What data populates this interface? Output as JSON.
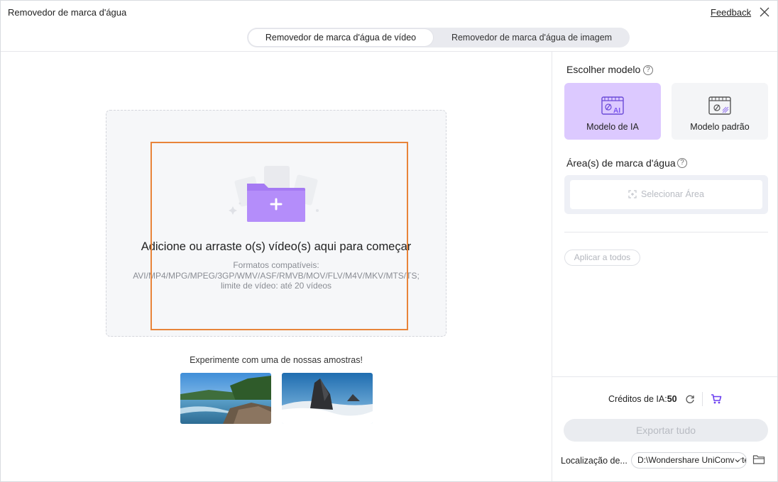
{
  "window": {
    "title": "Removedor de marca d'água",
    "feedback_label": "Feedback"
  },
  "tabs": [
    {
      "label": "Removedor de marca d'água de vídeo",
      "active": true
    },
    {
      "label": "Removedor de marca d'água de imagem",
      "active": false
    }
  ],
  "dropzone": {
    "title": "Adicione ou arraste o(s) vídeo(s) aqui para começar",
    "formats_label": "Formatos compatíveis:",
    "formats": "AVI/MP4/MPG/MPEG/3GP/WMV/ASF/RMVB/MOV/FLV/M4V/MKV/MTS/TS;",
    "limit": "limite de vídeo: até 20 vídeos"
  },
  "samples": {
    "label": "Experimente com uma de nossas amostras!"
  },
  "right_panel": {
    "model_section_title": "Escolher modelo",
    "models": [
      {
        "label": "Modelo de IA",
        "selected": true,
        "icon": "ai-model-icon"
      },
      {
        "label": "Modelo padrão",
        "selected": false,
        "icon": "standard-model-icon"
      }
    ],
    "area_section_title": "Área(s) de marca d'água",
    "select_area_label": "Selecionar Área",
    "apply_all_label": "Aplicar a todos",
    "credits_label": "Créditos de IA:",
    "credits_value": "50",
    "export_label": "Exportar tudo",
    "location_label": "Localização de...",
    "location_value": "D:\\Wondershare UniConverter"
  },
  "colors": {
    "accent": "#9b6cf7",
    "selected_card_bg": "#dcc9ff",
    "highlight_border": "#e8843a"
  }
}
